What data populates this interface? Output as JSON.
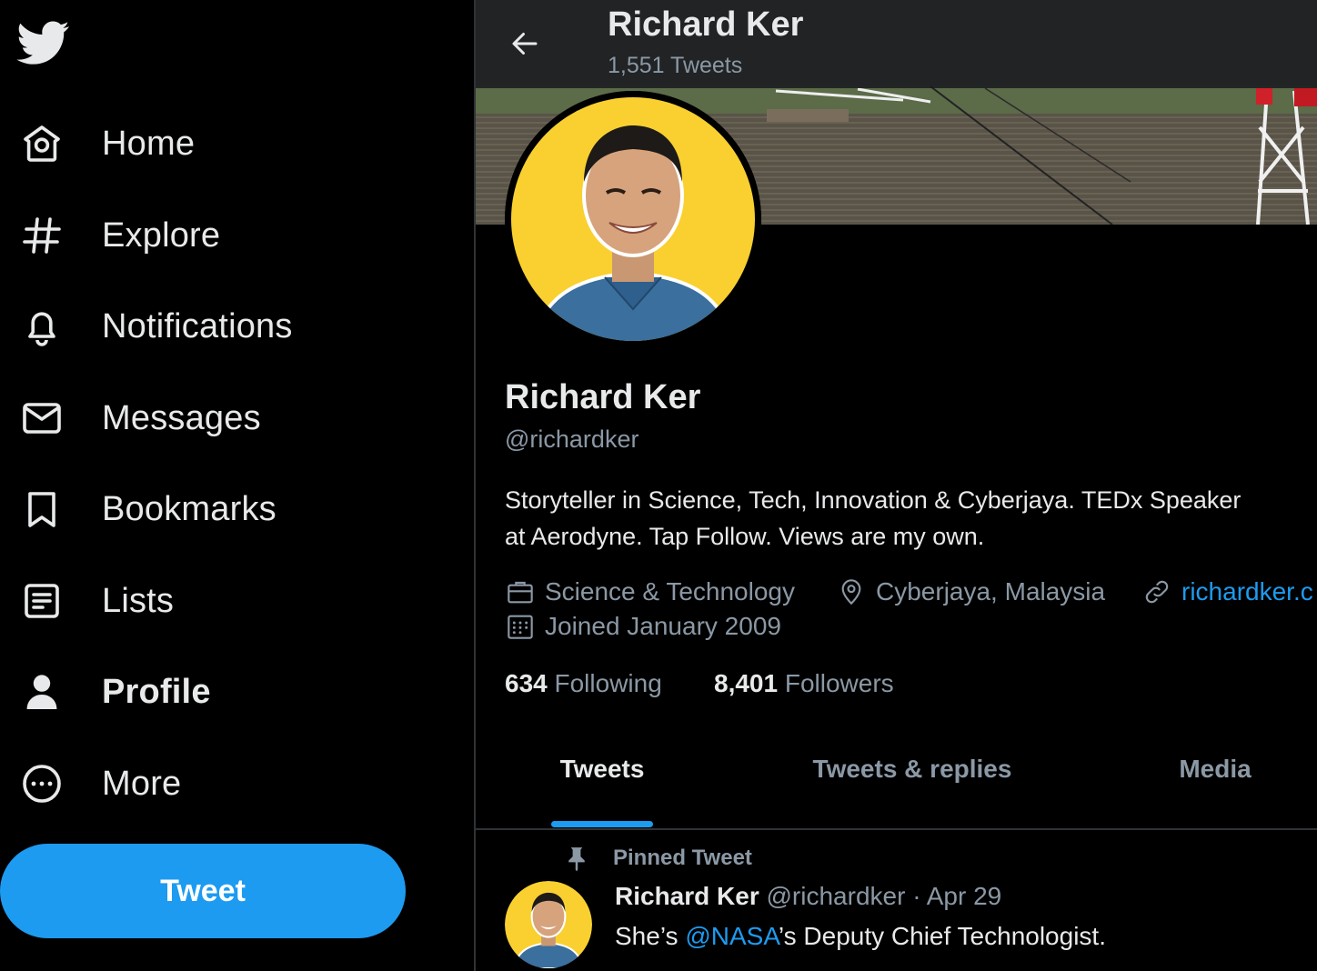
{
  "sidebar": {
    "logo_icon": "twitter-bird-icon",
    "items": [
      {
        "label": "Home",
        "icon": "home-icon"
      },
      {
        "label": "Explore",
        "icon": "hashtag-icon"
      },
      {
        "label": "Notifications",
        "icon": "bell-icon"
      },
      {
        "label": "Messages",
        "icon": "envelope-icon"
      },
      {
        "label": "Bookmarks",
        "icon": "bookmark-icon"
      },
      {
        "label": "Lists",
        "icon": "list-icon"
      },
      {
        "label": "Profile",
        "icon": "person-icon",
        "active": true
      },
      {
        "label": "More",
        "icon": "more-circle-icon"
      }
    ],
    "tweet_button": "Tweet"
  },
  "header": {
    "name": "Richard Ker",
    "tweet_count": "1,551 Tweets"
  },
  "profile": {
    "name": "Richard Ker",
    "handle": "@richardker",
    "bio_line1": "Storyteller in Science, Tech, Innovation & Cyberjaya. TEDx Speaker",
    "bio_line2": "at Aerodyne. Tap Follow. Views are my own.",
    "category": "Science & Technology",
    "location": "Cyberjaya, Malaysia",
    "website": "richardker.c",
    "joined": "Joined January 2009",
    "following_count": "634",
    "following_label": "Following",
    "followers_count": "8,401",
    "followers_label": "Followers"
  },
  "tabs": [
    {
      "label": "Tweets",
      "active": true
    },
    {
      "label": "Tweets & replies"
    },
    {
      "label": "Media"
    }
  ],
  "pinned_tweet": {
    "pinned_label": "Pinned Tweet",
    "author_name": "Richard Ker",
    "author_handle": "@richardker",
    "separator": "·",
    "date": "Apr 29",
    "text_before": "She’s ",
    "mention": "@NASA",
    "text_after": "’s Deputy Chief Technologist."
  },
  "colors": {
    "accent": "#1d9bf0",
    "background": "#000000",
    "text_primary": "#e7e9ea",
    "text_secondary": "#8b98a5",
    "avatar_bg": "#f9d030"
  }
}
